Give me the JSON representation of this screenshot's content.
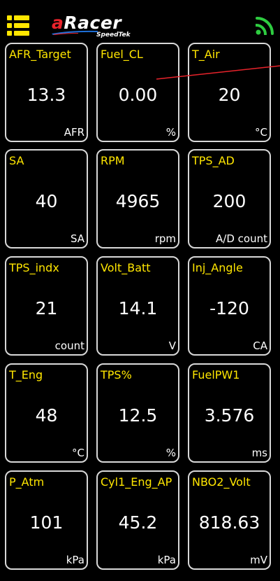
{
  "header": {
    "logo_main_a": "a",
    "logo_main_rest": "Racer",
    "logo_sub": "SpeedTek",
    "menu_icon": "menu-list-icon",
    "connection_icon": "signal-wifi-icon",
    "colors": {
      "menu_icon": "#ffe600",
      "connection_icon": "#2ecc40",
      "logo_accent": "#e8232b",
      "logo_swoosh": "#1e6fd8"
    }
  },
  "tile_style": {
    "name_color": "#ffe600",
    "value_color": "#ffffff",
    "border_color": "#d8d8d8",
    "background": "#000000"
  },
  "tiles": [
    {
      "name": "AFR_Target",
      "value": "13.3",
      "unit": "AFR"
    },
    {
      "name": "Fuel_CL",
      "value": "0.00",
      "unit": "%"
    },
    {
      "name": "T_Air",
      "value": "20",
      "unit": "°C"
    },
    {
      "name": "SA",
      "value": "40",
      "unit": "SA"
    },
    {
      "name": "RPM",
      "value": "4965",
      "unit": "rpm"
    },
    {
      "name": "TPS_AD",
      "value": "200",
      "unit": "A/D count"
    },
    {
      "name": "TPS_indx",
      "value": "21",
      "unit": "count"
    },
    {
      "name": "Volt_Batt",
      "value": "14.1",
      "unit": "V"
    },
    {
      "name": "Inj_Angle",
      "value": "-120",
      "unit": "CA"
    },
    {
      "name": "T_Eng",
      "value": "48",
      "unit": "°C"
    },
    {
      "name": "TPS%",
      "value": "12.5",
      "unit": "%"
    },
    {
      "name": "FuelPW1",
      "value": "3.576",
      "unit": "ms"
    },
    {
      "name": "P_Atm",
      "value": "101",
      "unit": "kPa"
    },
    {
      "name": "Cyl1_Eng_AP",
      "value": "45.2",
      "unit": "kPa"
    },
    {
      "name": "NBO2_Volt",
      "value": "818.63",
      "unit": "mV"
    }
  ]
}
